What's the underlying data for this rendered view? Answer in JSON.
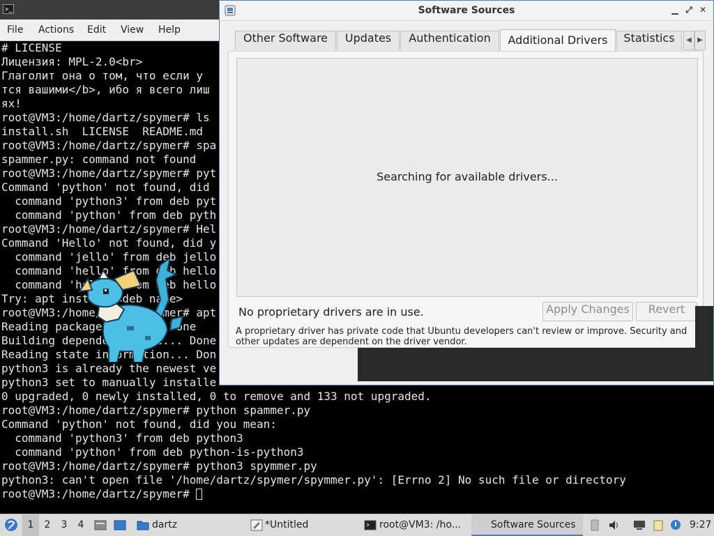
{
  "terminal": {
    "menu": [
      "File",
      "Actions",
      "Edit",
      "View",
      "Help"
    ],
    "lines": [
      "# LICENSE",
      "Лицензия: MPL-2.0<br>",
      "Глаголит она о том, что если у ",
      "тся вашими</b>, ибо я всего лиш",
      "ях!",
      "root@VM3:/home/dartz/spymer# ls",
      "install.sh  LICENSE  README.md",
      "root@VM3:/home/dartz/spymer# spa",
      "spammer.py: command not found",
      "root@VM3:/home/dartz/spymer# pyt",
      "Command 'python' not found, did ",
      "  command 'python3' from deb pyt",
      "  command 'python' from deb pyth",
      "root@VM3:/home/dartz/spymer# Hel",
      "Command 'Hello' not found, did y",
      "  command 'jello' from deb jello",
      "  command 'hello' from deb hello",
      "  command 'hello' from deb hello",
      "Try: apt install <deb name>",
      "root@VM3:/home/dartz/spymer# apt",
      "Reading package lists... Done",
      "Building dependency tree... Done",
      "Reading state information... Don",
      "python3 is already the newest ve",
      "python3 set to manually installe",
      "0 upgraded, 0 newly installed, 0 to remove and 133 not upgraded.",
      "root@VM3:/home/dartz/spymer# python spammer.py",
      "Command 'python' not found, did you mean:",
      "  command 'python3' from deb python3",
      "  command 'python' from deb python-is-python3",
      "root@VM3:/home/dartz/spymer# python3 spymmer.py",
      "python3: can't open file '/home/dartz/spymer/spymmer.py': [Errno 2] No such file or directory",
      "root@VM3:/home/dartz/spymer# "
    ]
  },
  "dialog": {
    "title": "Software Sources",
    "tabs": [
      "Other Software",
      "Updates",
      "Authentication",
      "Additional Drivers",
      "Statistics"
    ],
    "active_tab": "Additional Drivers",
    "searching_text": "Searching for available drivers...",
    "status_text": "No proprietary drivers are in use.",
    "apply_label": "Apply Changes",
    "revert_label": "Revert",
    "note": "A proprietary driver has private code that Ubuntu developers can't review or improve. Security and other updates are dependent on the driver vendor."
  },
  "taskbar": {
    "workspaces": [
      "1",
      "2",
      "3",
      "4"
    ],
    "folder_label": "dartz",
    "tasks": [
      "*Untitled",
      "root@VM3: /ho...",
      "Software Sources"
    ],
    "clock": "9:27"
  },
  "colors": {
    "terminal_bg": "#000000",
    "terminal_fg": "#e6e6e6",
    "dialog_border": "#5b7fa8",
    "taskbar_accent": "#4a7cc9"
  }
}
